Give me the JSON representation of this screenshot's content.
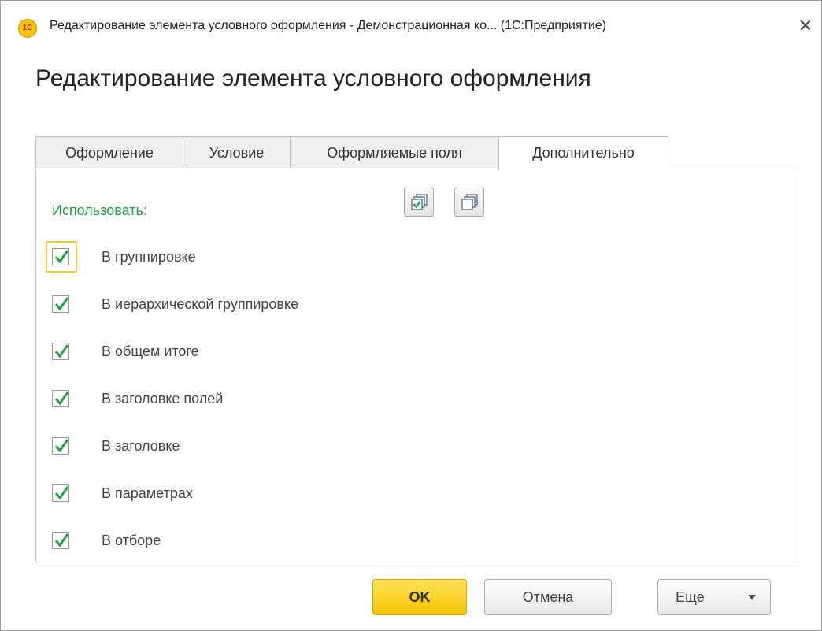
{
  "window": {
    "title": "Редактирование элемента условного оформления - Демонстрационная ко...  (1С:Предприятие)",
    "close_glyph": "✕",
    "logo_text": "1С"
  },
  "form": {
    "title": "Редактирование элемента условного оформления"
  },
  "tabs": [
    {
      "label": "Оформление",
      "active": false
    },
    {
      "label": "Условие",
      "active": false
    },
    {
      "label": "Оформляемые поля",
      "active": false
    },
    {
      "label": "Дополнительно",
      "active": true
    }
  ],
  "panel": {
    "use_label": "Использовать:",
    "buttons": [
      {
        "icon": "check-all-icon"
      },
      {
        "icon": "uncheck-all-icon"
      }
    ],
    "checkboxes": [
      {
        "label": "В группировке",
        "checked": true,
        "focused": true
      },
      {
        "label": "В иерархической группировке",
        "checked": true,
        "focused": false
      },
      {
        "label": "В общем итоге",
        "checked": true,
        "focused": false
      },
      {
        "label": "В заголовке полей",
        "checked": true,
        "focused": false
      },
      {
        "label": "В заголовке",
        "checked": true,
        "focused": false
      },
      {
        "label": "В параметрах",
        "checked": true,
        "focused": false
      },
      {
        "label": "В отборе",
        "checked": true,
        "focused": false
      }
    ]
  },
  "footer": {
    "ok_label": "OK",
    "cancel_label": "Отмена",
    "more_label": "Еще"
  },
  "colors": {
    "accent_green": "#20a040",
    "ok_yellow": "#f2c300",
    "focus_yellow": "#f5c842"
  }
}
